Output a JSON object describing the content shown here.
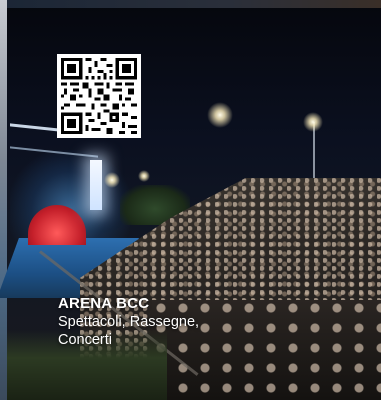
{
  "caption": {
    "title": "ARENA BCC",
    "line1": "Spettacoli, Rassegne,",
    "line2": "Concerti"
  },
  "qr": {
    "icon": "qr-code-icon"
  },
  "colors": {
    "caption_text": "#ffffff",
    "stage_blue": "#2d6fb0",
    "stage_red": "#c41f2a",
    "sky": "#05070d"
  }
}
